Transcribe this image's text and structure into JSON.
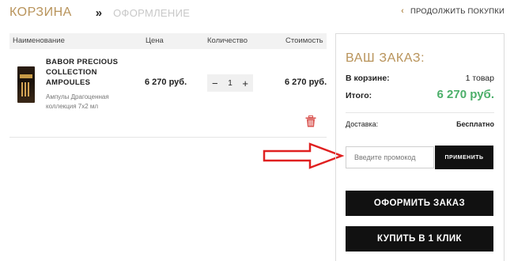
{
  "steps": {
    "current": "КОРЗИНА",
    "separator": "»",
    "next": "ОФОРМЛЕНИЕ"
  },
  "continue_shopping": {
    "icon": "chevron-left-icon",
    "label": "ПРОДОЛЖИТЬ ПОКУПКИ"
  },
  "cart": {
    "columns": [
      "Наименование",
      "Цена",
      "Количество",
      "Стоимость"
    ],
    "items": [
      {
        "name": "BABOR PRECIOUS COLLECTION AMPOULES",
        "description": "Ампулы Драгоценная коллекция 7х2 мл",
        "price": "6 270 руб.",
        "quantity": "1",
        "total": "6 270 руб."
      }
    ],
    "qty_minus": "−",
    "qty_plus": "+",
    "remove_icon": "trash-icon"
  },
  "summary": {
    "title": "ВАШ ЗАКАЗ:",
    "cart_label": "В корзине:",
    "cart_value": "1 товар",
    "total_label": "Итого:",
    "total_value": "6 270 руб.",
    "delivery_label": "Доставка:",
    "delivery_value": "Бесплатно",
    "promo_placeholder": "Введите промокод",
    "apply_label": "ПРИМЕНИТЬ",
    "checkout_label": "ОФОРМИТЬ ЗАКАЗ",
    "one_click_label": "КУПИТЬ В 1 КЛИК"
  },
  "colors": {
    "accent": "#b8935a",
    "total": "#4caf6a",
    "button": "#111111",
    "arrow": "#e02020"
  }
}
